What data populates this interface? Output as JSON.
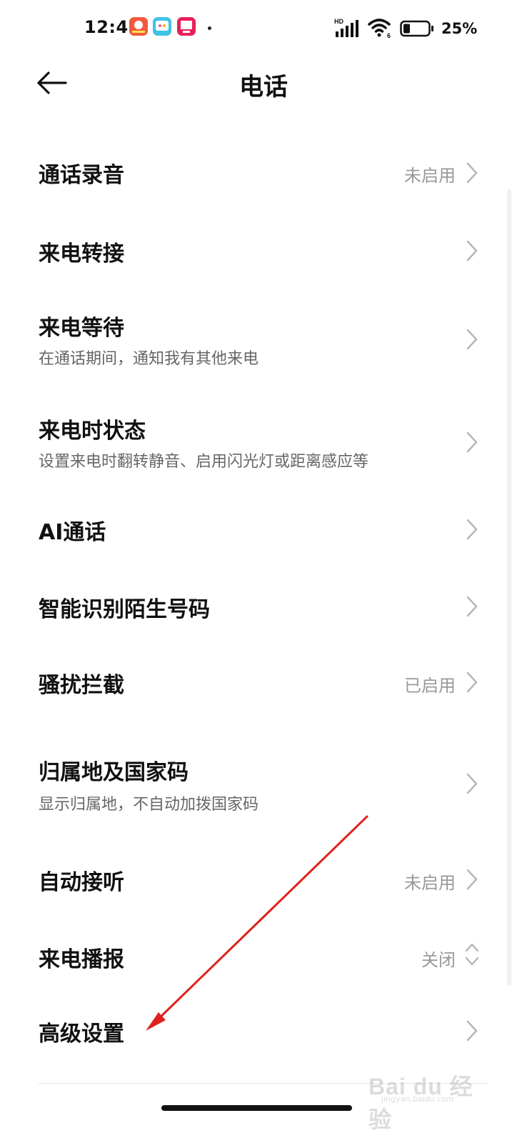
{
  "status_bar": {
    "time": "12:47",
    "battery_percent": "25%",
    "network_label": "HD",
    "wifi_label": "6"
  },
  "header": {
    "title": "电话"
  },
  "items": [
    {
      "label": "通话录音",
      "value": "未启用"
    },
    {
      "label": "来电转接",
      "value": ""
    },
    {
      "label": "来电等待",
      "subtitle": "在通话期间，通知我有其他来电"
    },
    {
      "label": "来电时状态",
      "subtitle": "设置来电时翻转静音、启用闪光灯或距离感应等"
    },
    {
      "label": "AI通话",
      "value": ""
    },
    {
      "label": "智能识别陌生号码",
      "value": ""
    },
    {
      "label": "骚扰拦截",
      "value": "已启用"
    },
    {
      "label": "归属地及国家码",
      "subtitle": "显示归属地，不自动加拨国家码"
    },
    {
      "label": "自动接听",
      "value": "未启用"
    },
    {
      "label": "来电播报",
      "value": "关闭"
    },
    {
      "label": "高级设置",
      "value": ""
    }
  ],
  "watermark": {
    "brand": "Bai du 经验",
    "url": "jingyan.baidu.com"
  },
  "colors": {
    "annotation": "#e0201b",
    "secondary_text": "#999999"
  }
}
